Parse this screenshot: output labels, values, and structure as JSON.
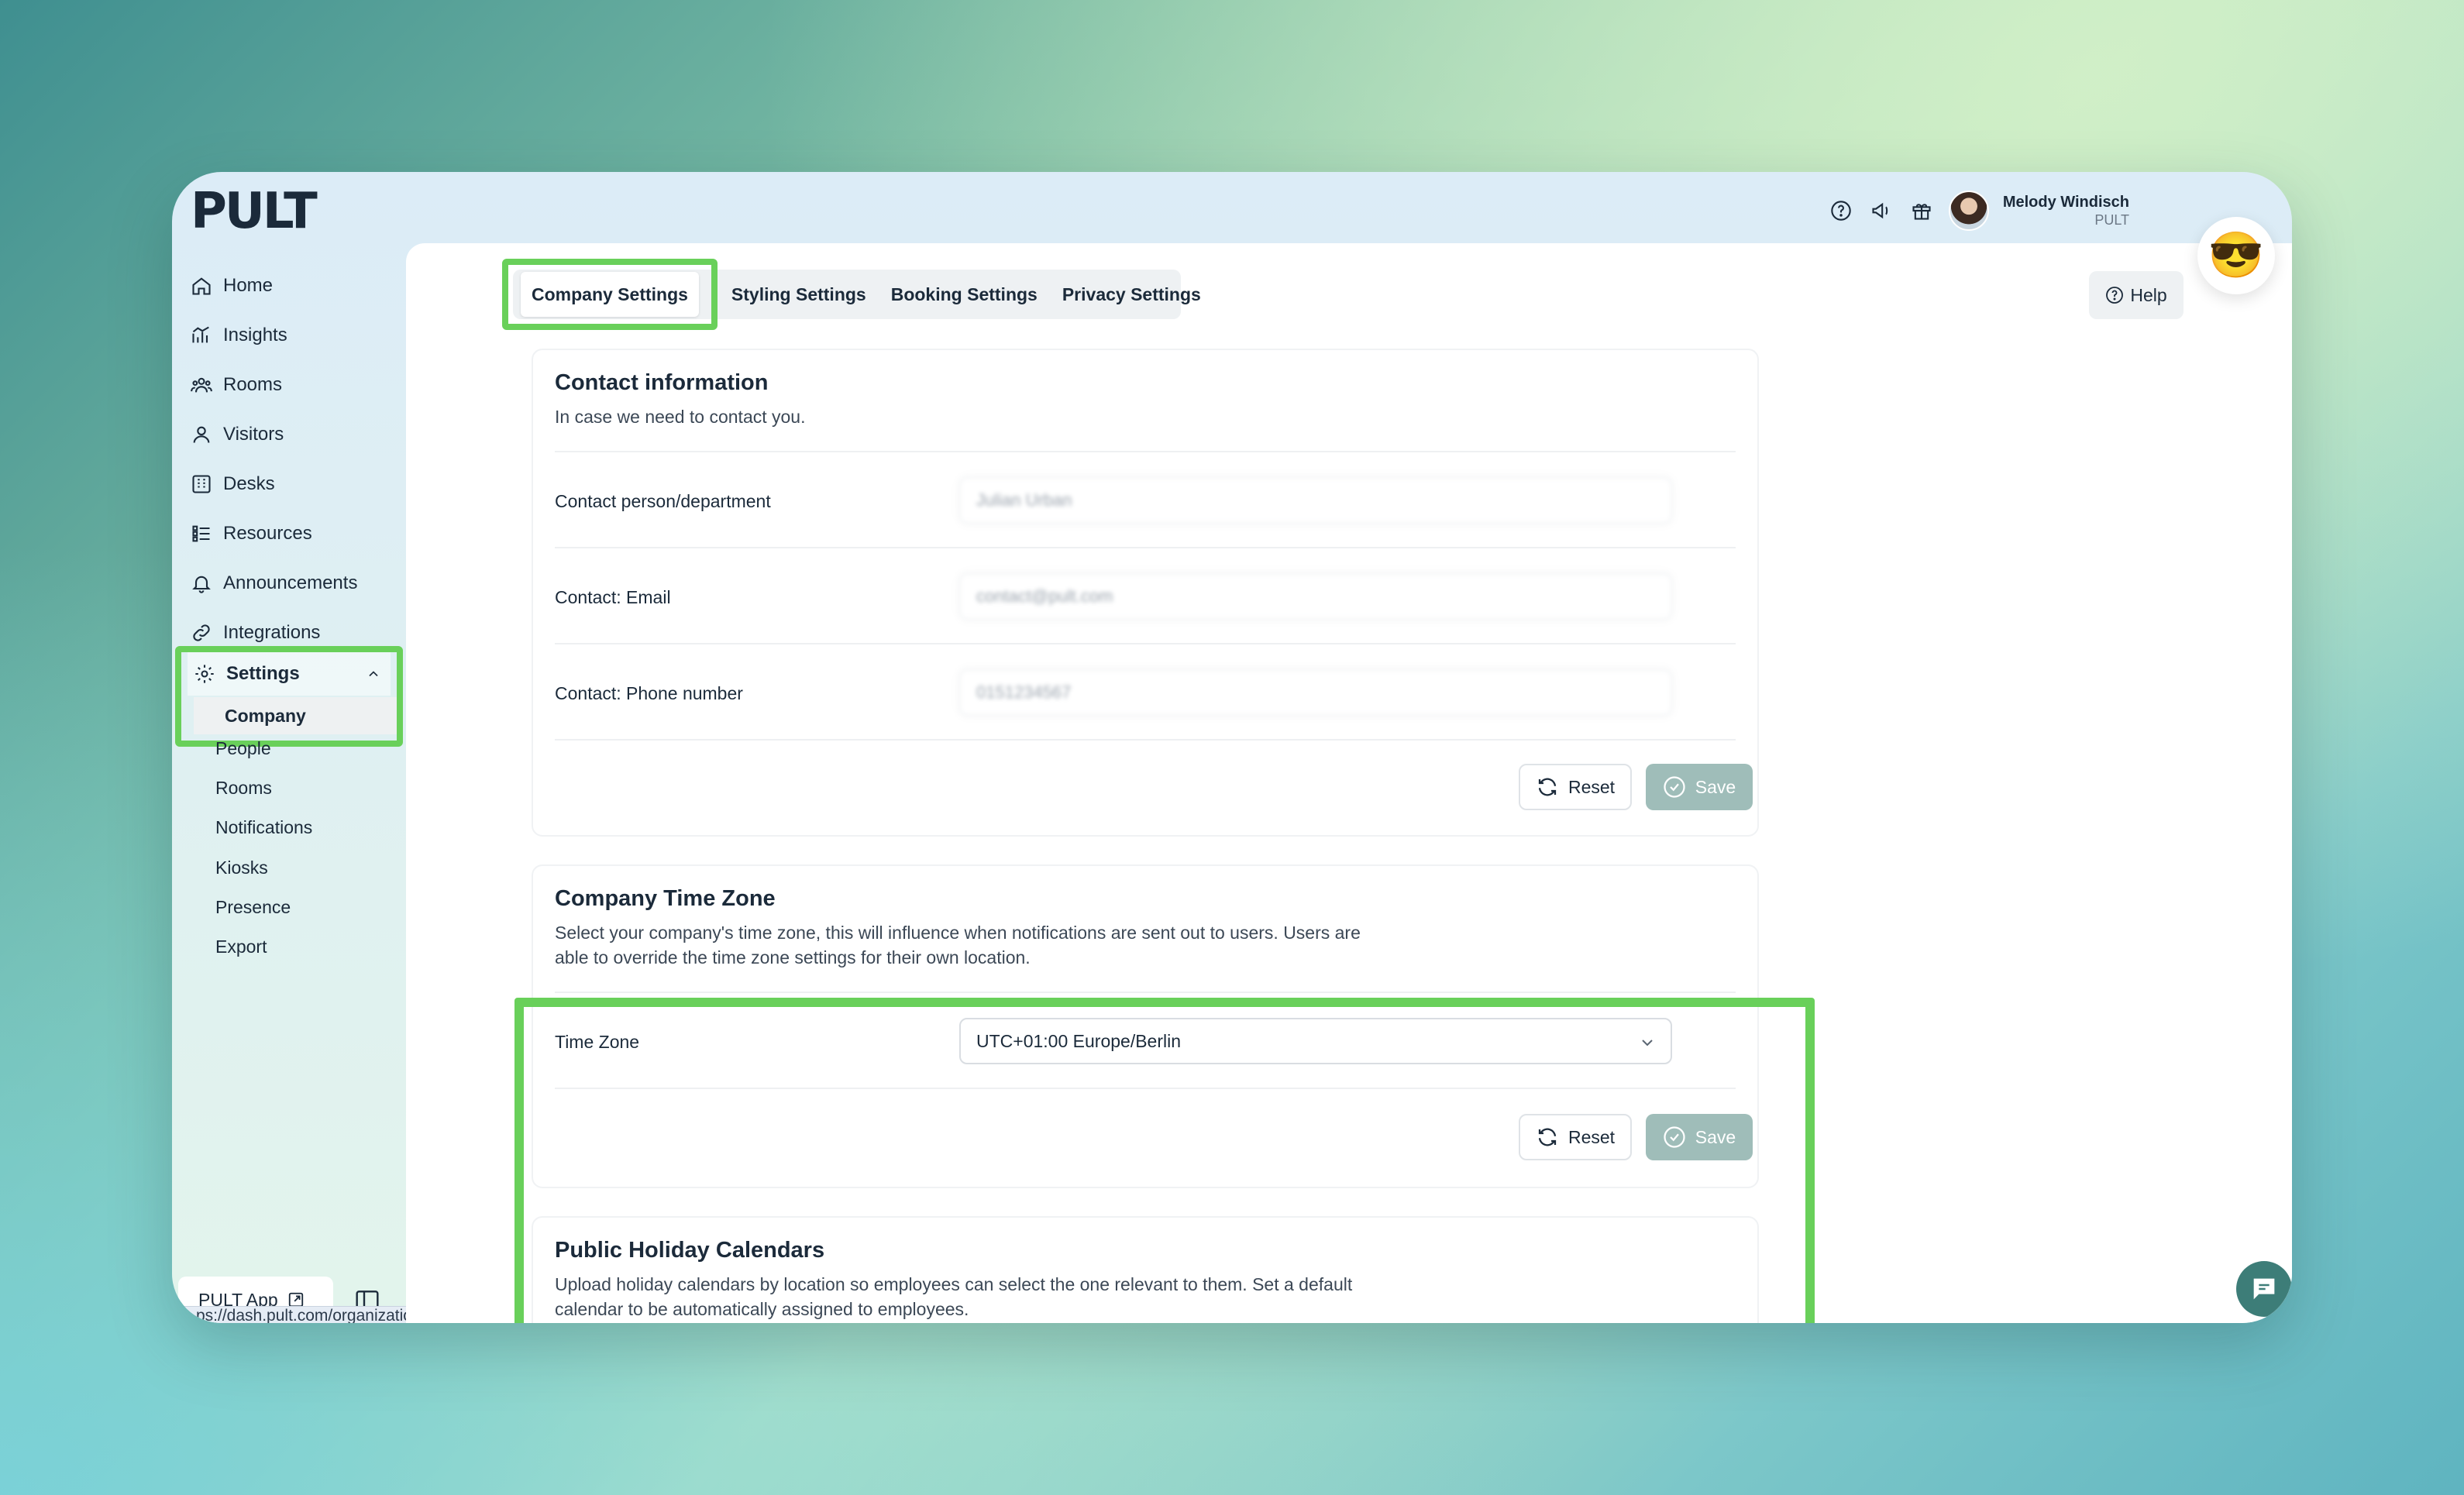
{
  "app": {
    "logo": "PULT",
    "user_name": "Melody Windisch",
    "user_org": "PULT",
    "emoji": "😎"
  },
  "sidebar": {
    "items": [
      {
        "label": "Home",
        "icon": "home-icon"
      },
      {
        "label": "Insights",
        "icon": "chart-icon"
      },
      {
        "label": "Rooms",
        "icon": "people-icon"
      },
      {
        "label": "Visitors",
        "icon": "person-icon"
      },
      {
        "label": "Desks",
        "icon": "building-icon"
      },
      {
        "label": "Resources",
        "icon": "list-icon"
      },
      {
        "label": "Announcements",
        "icon": "bell-icon"
      },
      {
        "label": "Integrations",
        "icon": "link-icon"
      }
    ],
    "settings": {
      "label": "Settings",
      "active_sub": "Company",
      "subitems": [
        "People",
        "Rooms",
        "Notifications",
        "Kiosks",
        "Presence",
        "Export"
      ]
    },
    "pult_app": "PULT App",
    "status_url": "ps://dash.pult.com/organization/ai-meeting-recommendations"
  },
  "tabs": {
    "items": [
      "Company Settings",
      "Styling Settings",
      "Booking Settings",
      "Privacy Settings"
    ],
    "active": "Company Settings"
  },
  "help_label": "Help",
  "contact_card": {
    "title": "Contact information",
    "description": "In case we need to contact you.",
    "rows": [
      {
        "label": "Contact person/department",
        "value": "Julian Urban"
      },
      {
        "label": "Contact: Email",
        "value": "contact@pult.com"
      },
      {
        "label": "Contact: Phone number",
        "value": "0151234567"
      }
    ],
    "reset_label": "Reset",
    "save_label": "Save"
  },
  "timezone_card": {
    "title": "Company Time Zone",
    "description": "Select your company's time zone, this will influence when notifications are sent out to users. Users are able to override the time zone settings for their own location.",
    "row_label": "Time Zone",
    "selected": "UTC+01:00 Europe/Berlin",
    "reset_label": "Reset",
    "save_label": "Save"
  },
  "holiday_card": {
    "title": "Public Holiday Calendars",
    "description": "Upload holiday calendars by location so employees can select the one relevant to them. Set a default calendar to be automatically assigned to employees."
  },
  "colors": {
    "highlight": "#69d05a",
    "save_disabled": "#9fbdb9",
    "chat": "#3d7d78"
  }
}
